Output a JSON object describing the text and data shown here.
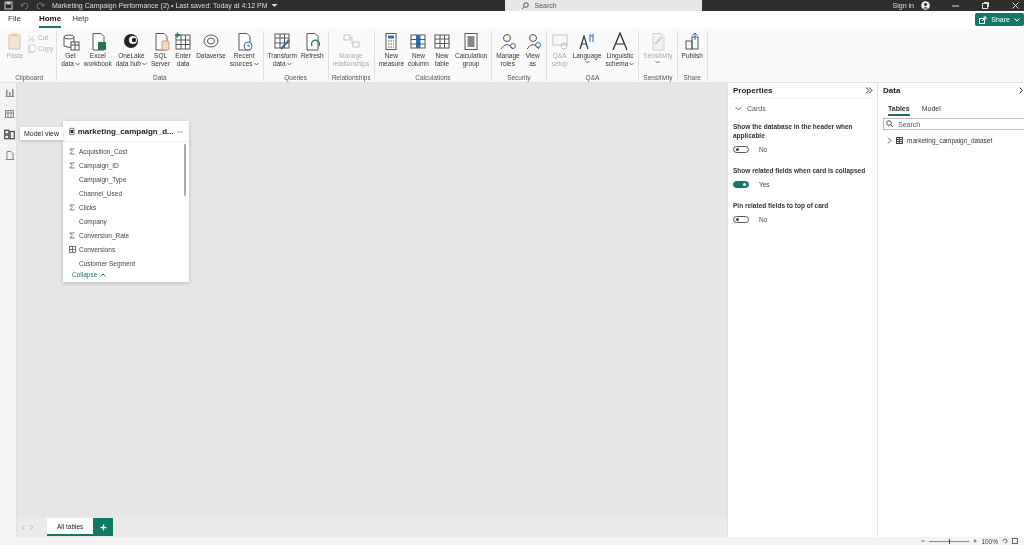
{
  "title_bar": {
    "title": "Marketing Campaign Performance (2) • Last saved: Today at 4:12 PM",
    "search_placeholder": "Search",
    "sign_in": "Sign in"
  },
  "menu_tabs": [
    {
      "label": "File",
      "selected": false
    },
    {
      "label": "Home",
      "selected": true
    },
    {
      "label": "Help",
      "selected": false
    }
  ],
  "share_button": "Share",
  "ribbon_groups": [
    {
      "name": "Clipboard",
      "buttons": [
        {
          "label": "Paste",
          "disabled": true,
          "dropdown": false,
          "kind": "large"
        },
        {
          "label": "Cut",
          "disabled": true,
          "dropdown": false,
          "kind": "small"
        },
        {
          "label": "Copy",
          "disabled": true,
          "dropdown": false,
          "kind": "small"
        }
      ]
    },
    {
      "name": "Data",
      "buttons": [
        {
          "label": "Get\ndata",
          "disabled": false,
          "dropdown": true,
          "kind": "large"
        },
        {
          "label": "Excel\nworkbook",
          "disabled": false,
          "dropdown": false,
          "kind": "large"
        },
        {
          "label": "OneLake\ndata hub",
          "disabled": false,
          "dropdown": true,
          "kind": "large"
        },
        {
          "label": "SQL\nServer",
          "disabled": false,
          "dropdown": false,
          "kind": "large"
        },
        {
          "label": "Enter\ndata",
          "disabled": false,
          "dropdown": false,
          "kind": "large"
        },
        {
          "label": "Dataverse",
          "disabled": false,
          "dropdown": false,
          "kind": "large"
        },
        {
          "label": "Recent\nsources",
          "disabled": false,
          "dropdown": true,
          "kind": "large"
        }
      ]
    },
    {
      "name": "Queries",
      "buttons": [
        {
          "label": "Transform\ndata",
          "disabled": false,
          "dropdown": true,
          "kind": "large"
        },
        {
          "label": "Refresh",
          "disabled": false,
          "dropdown": false,
          "kind": "large"
        }
      ]
    },
    {
      "name": "Relationships",
      "buttons": [
        {
          "label": "Manage\nrelationships",
          "disabled": true,
          "dropdown": false,
          "kind": "large"
        }
      ]
    },
    {
      "name": "Calculations",
      "buttons": [
        {
          "label": "New\nmeasure",
          "disabled": false,
          "dropdown": false,
          "kind": "large"
        },
        {
          "label": "New\ncolumn",
          "disabled": false,
          "dropdown": false,
          "kind": "large"
        },
        {
          "label": "New\ntable",
          "disabled": false,
          "dropdown": false,
          "kind": "large"
        },
        {
          "label": "Calculation\ngroup",
          "disabled": false,
          "dropdown": false,
          "kind": "large"
        }
      ]
    },
    {
      "name": "Security",
      "buttons": [
        {
          "label": "Manage\nroles",
          "disabled": false,
          "dropdown": false,
          "kind": "large"
        },
        {
          "label": "View\nas",
          "disabled": false,
          "dropdown": false,
          "kind": "large"
        }
      ]
    },
    {
      "name": "Q&A",
      "buttons": [
        {
          "label": "Q&A\nsetup",
          "disabled": true,
          "dropdown": false,
          "kind": "large"
        },
        {
          "label": "Language",
          "disabled": false,
          "dropdown": true,
          "kind": "large"
        },
        {
          "label": "Linguistic\nschema",
          "disabled": false,
          "dropdown": true,
          "kind": "large"
        }
      ]
    },
    {
      "name": "Sensitivity",
      "buttons": [
        {
          "label": "Sensitivity",
          "disabled": true,
          "dropdown": true,
          "kind": "large"
        }
      ]
    },
    {
      "name": "Share",
      "buttons": [
        {
          "label": "Publish",
          "disabled": false,
          "dropdown": false,
          "kind": "large"
        }
      ]
    }
  ],
  "left_nav": [
    {
      "selected": false
    },
    {
      "selected": false
    },
    {
      "selected": true
    },
    {
      "selected": false
    }
  ],
  "tooltip": "Model view",
  "table_card": {
    "title": "marketing_campaign_d...",
    "fields": [
      {
        "name": "Acquisition_Cost",
        "kind": "sum"
      },
      {
        "name": "Campaign_ID",
        "kind": "sum"
      },
      {
        "name": "Campaign_Type",
        "kind": "text"
      },
      {
        "name": "Channel_Used",
        "kind": "text"
      },
      {
        "name": "Clicks",
        "kind": "sum"
      },
      {
        "name": "Company",
        "kind": "text"
      },
      {
        "name": "Conversion_Rate",
        "kind": "sum"
      },
      {
        "name": "Conversions",
        "kind": "calc"
      },
      {
        "name": "Customer Segment",
        "kind": "text"
      }
    ],
    "collapse": "Collapse"
  },
  "bottom_tabs": [
    {
      "label": "All tables",
      "selected": true
    }
  ],
  "properties": {
    "title": "Properties",
    "section": "Cards",
    "settings": [
      {
        "label": "Show the database in the header when applicable",
        "on": false,
        "state_label": "No"
      },
      {
        "label": "Show related fields when card is collapsed",
        "on": true,
        "state_label": "Yes"
      },
      {
        "label": "Pin related fields to top of card",
        "on": false,
        "state_label": "No"
      }
    ]
  },
  "data_pane": {
    "title": "Data",
    "tabs": [
      {
        "label": "Tables",
        "selected": true
      },
      {
        "label": "Model",
        "selected": false
      }
    ],
    "search_placeholder": "Search",
    "tables": [
      {
        "name": "marketing_campaign_dataset",
        "expanded": false
      }
    ]
  },
  "status_bar": {
    "zoom": "100%",
    "level": 0.5
  }
}
